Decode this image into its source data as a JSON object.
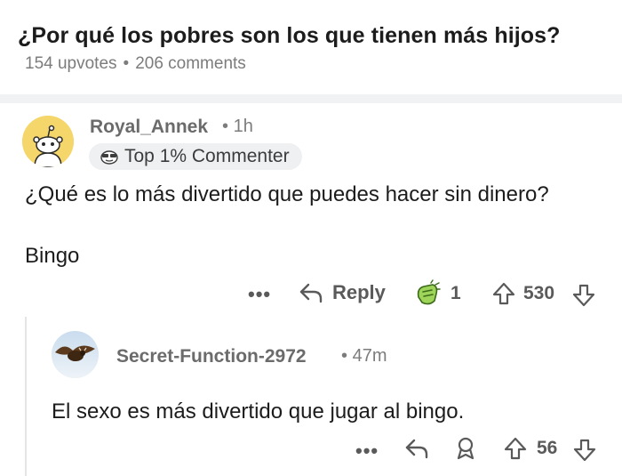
{
  "post": {
    "title": "¿Por qué los pobres son los que tienen más hijos?",
    "upvotes": "154 upvotes",
    "separator": "•",
    "comments": "206 comments"
  },
  "comment1": {
    "username": "Royal_Annek",
    "separator": "•",
    "time": "1h",
    "badge": "Top 1% Commenter",
    "line1": "¿Qué es lo más divertido que puedes hacer sin dinero?",
    "line2": "Bingo",
    "more": "•••",
    "reply_label": "Reply",
    "award_count": "1",
    "vote_count": "530"
  },
  "comment2": {
    "username": "Secret-Function-2972",
    "separator": "•",
    "time": "47m",
    "text": "El sexo es más divertido que jugar al bingo.",
    "more": "•••",
    "vote_count": "56"
  },
  "icons": {
    "more": "more-options-icon",
    "reply": "reply-arrow-icon",
    "award": "award-icon",
    "upvote": "upvote-arrow-icon",
    "downvote": "downvote-arrow-icon"
  },
  "colors": {
    "meta_text": "#7c7c7c",
    "action_text": "#5a5a5a",
    "badge_bg": "#eef0f2",
    "separator_band": "#f1f2f3",
    "avatar_yellow": "#f5d66b"
  }
}
